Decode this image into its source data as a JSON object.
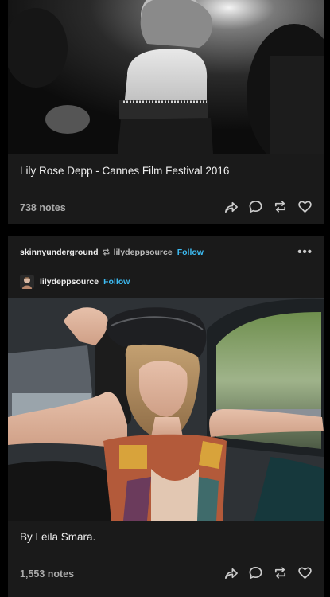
{
  "post1": {
    "caption": "Lily Rose Depp - Cannes Film Festival 2016",
    "notes": "738 notes"
  },
  "post2": {
    "reblogger": "skinnyunderground",
    "source": "lilydeppsource",
    "follow_source": "Follow",
    "author": "lilydeppsource",
    "follow_author": "Follow",
    "more": "•••",
    "caption": "By Leila Smara.",
    "notes": "1,553 notes"
  },
  "colors": {
    "background": "#000000",
    "card": "#1a1a1a",
    "follow": "#3dbbf2",
    "icon": "#cccccc"
  },
  "icons": [
    "share-icon",
    "reply-icon",
    "reblog-icon",
    "like-icon",
    "more-icon"
  ]
}
